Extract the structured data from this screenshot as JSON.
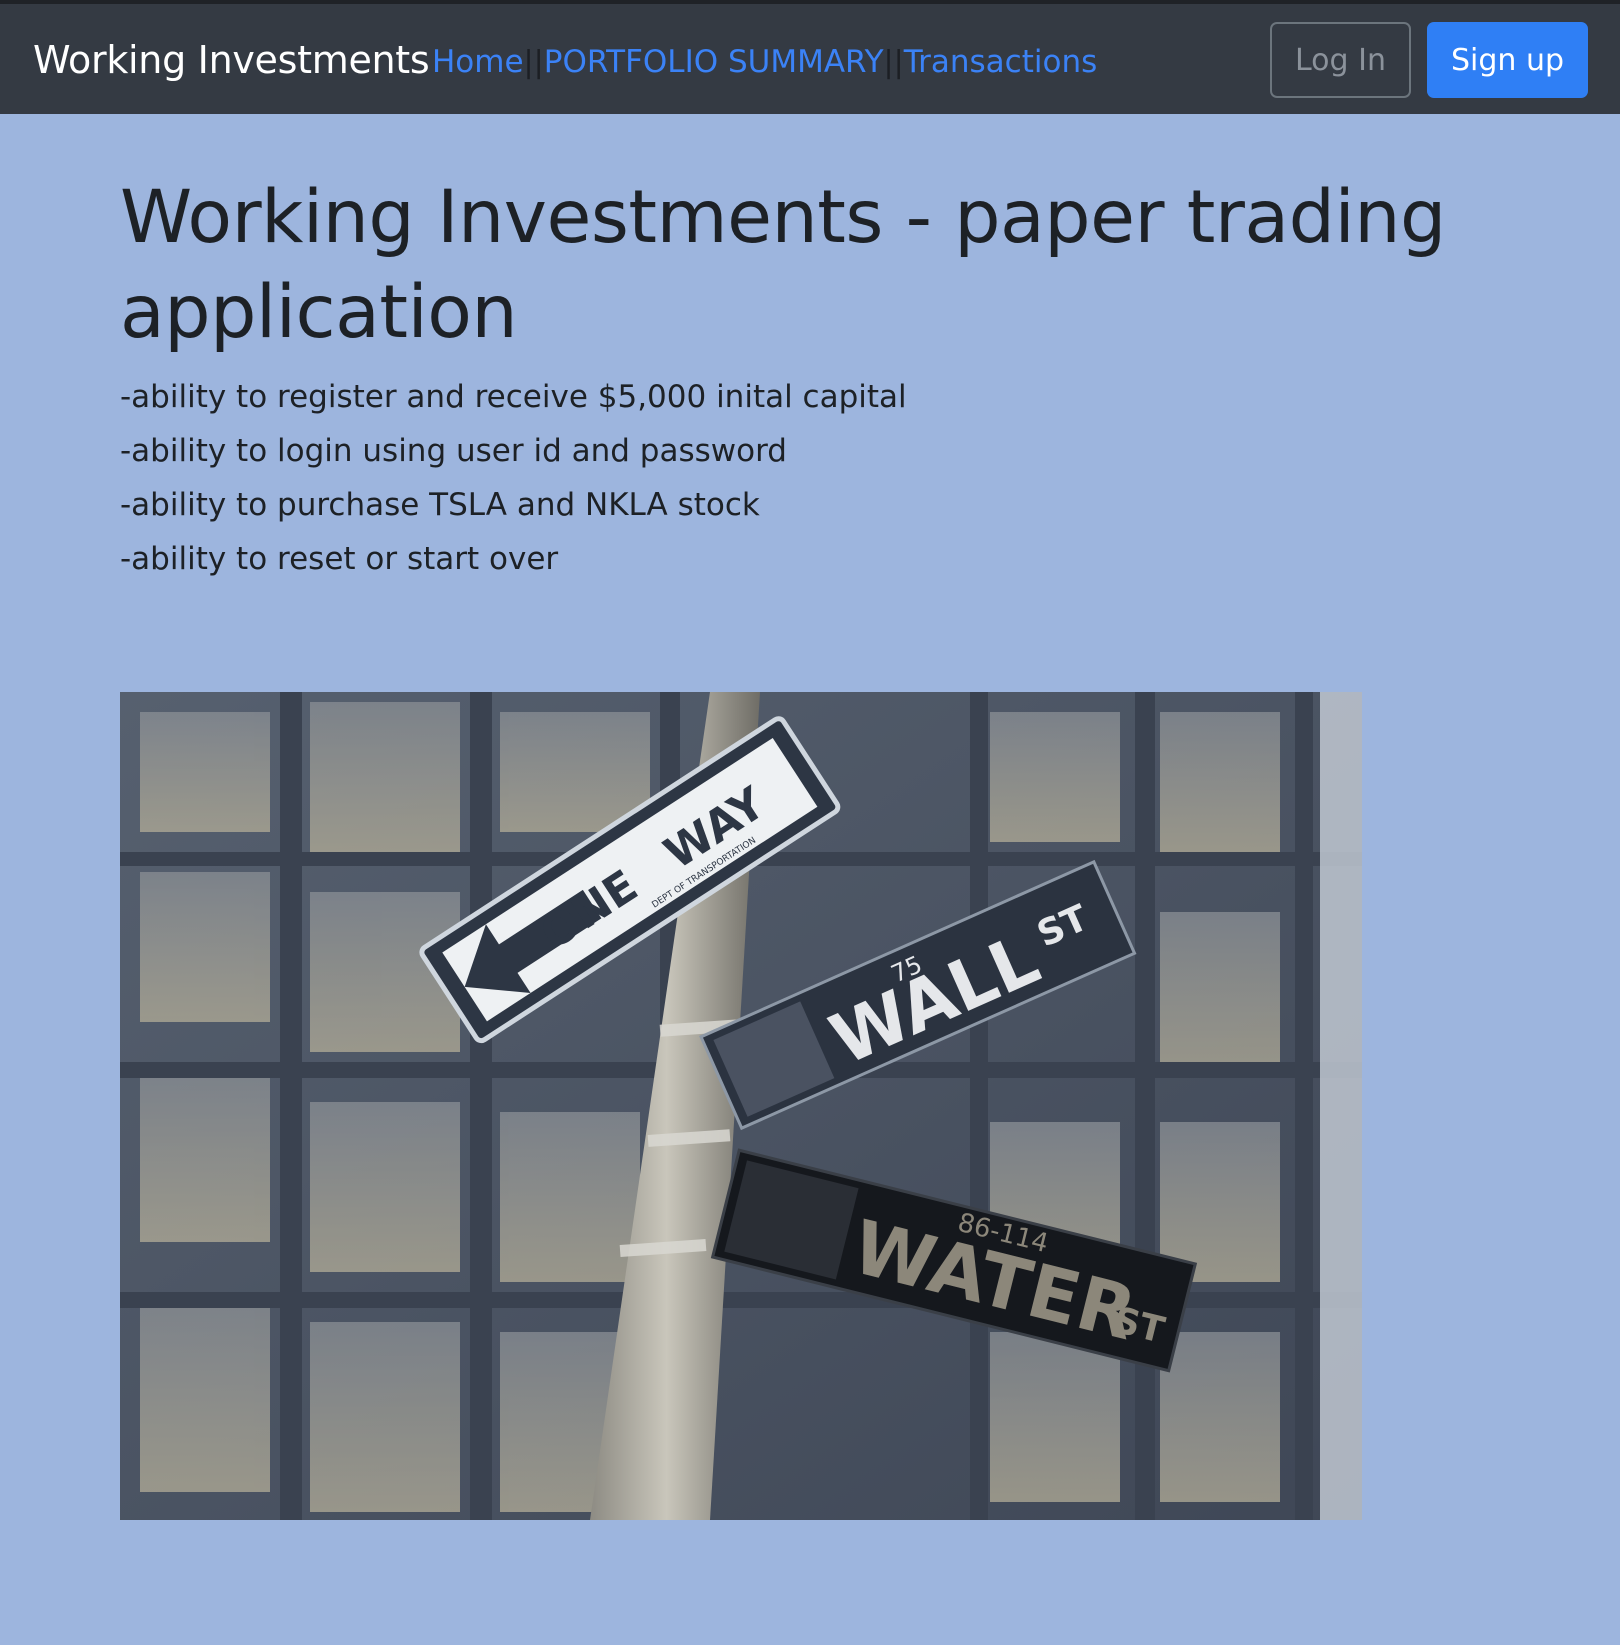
{
  "navbar": {
    "brand": "Working Investments",
    "links": [
      {
        "label": "Home"
      },
      {
        "label": "PORTFOLIO SUMMARY"
      },
      {
        "label": "Transactions"
      }
    ],
    "separator": "||",
    "login_label": "Log In",
    "signup_label": "Sign up"
  },
  "main": {
    "title": "Working Investments - paper trading application",
    "features": [
      "-ability to register and receive $5,000 inital capital",
      "-ability to login using user id and password",
      "-ability to purchase TSLA and NKLA stock",
      "-ability to reset or start over"
    ]
  },
  "hero_image": {
    "signs": {
      "one_way_left": "ONE",
      "one_way_right": "WAY",
      "one_way_small": "DEPT OF TRANSPORTATION",
      "wall_name": "WALL",
      "wall_suffix": "ST",
      "wall_number": "75",
      "water_name": "WATER",
      "water_suffix": "ST",
      "water_number": "86-114"
    }
  },
  "colors": {
    "navbar_bg": "#343a43",
    "page_bg": "#9db5de",
    "link": "#3b82f6",
    "primary_button": "#2f7ff5"
  }
}
